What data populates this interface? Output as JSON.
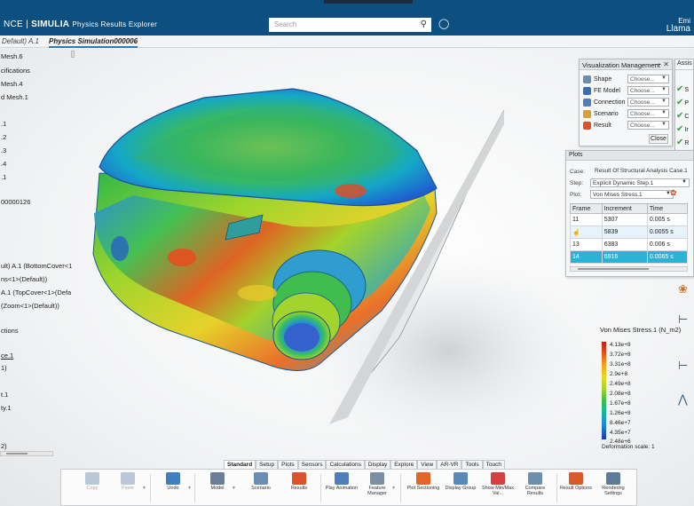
{
  "topbar": {
    "brand_left": "NCE |",
    "brand_mid": "SIMULIA",
    "brand_right": "Physics Results Explorer",
    "search_placeholder": "Search",
    "user_top": "Emi",
    "user_name": "Llama"
  },
  "tabs": [
    {
      "label": "Default) A.1"
    },
    {
      "label": "Physics Simulation000006"
    }
  ],
  "tree": [
    {
      "label": "Mesh.6",
      "y": 0
    },
    {
      "label": "cifications",
      "y": 1
    },
    {
      "label": "Mesh.4",
      "y": 2
    },
    {
      "label": "d Mesh.1",
      "y": 3
    },
    {
      "label": ".1",
      "y": 4
    },
    {
      "label": ".2",
      "y": 5
    },
    {
      "label": ".3",
      "y": 6
    },
    {
      "label": ".4",
      "y": 7
    },
    {
      "label": ".1",
      "y": 8
    },
    {
      "label": "00000126",
      "y": 9
    },
    {
      "label": "ult) A.1 (BottomCover<1",
      "y": 10
    },
    {
      "label": "ns<1>(Default))",
      "y": 11
    },
    {
      "label": "A.1 (TopCover<1>(Defa",
      "y": 12
    },
    {
      "label": "(Zoom<1>(Default))",
      "y": 13
    },
    {
      "label": "ctions",
      "y": 14
    },
    {
      "label": "ce.1",
      "y": 15
    },
    {
      "label": "1)",
      "y": 16
    },
    {
      "label": "t.1",
      "y": 17
    },
    {
      "label": "ty.1",
      "y": 18
    },
    {
      "label": "2)",
      "y": 19
    }
  ],
  "viz": {
    "title": "Visualization Management",
    "rows": [
      {
        "label": "Shape",
        "value": "Choose...",
        "color": "#6c8cb0"
      },
      {
        "label": "FE Model",
        "value": "Choose...",
        "color": "#3a6fb3"
      },
      {
        "label": "Connection",
        "value": "Choose...",
        "color": "#4f7fb8"
      },
      {
        "label": "Scenario",
        "value": "Choose...",
        "color": "#d4a133"
      },
      {
        "label": "Result",
        "value": "Choose...",
        "color": "#d8552f"
      }
    ],
    "close": "Close"
  },
  "assist": {
    "title": "Assis",
    "items": [
      "S",
      "P",
      "C",
      "Ir",
      "R"
    ]
  },
  "plots": {
    "title": "Plots",
    "case_label": "Case:",
    "case_value": "Result Of Structural Analysis Case.1",
    "step_label": "Step:",
    "step_value": "Explicit Dynamic Step.1",
    "plot_label": "Plot:",
    "plot_value": "Von Mises Stress.1",
    "headers": [
      "Frame",
      "Increment",
      "Time"
    ],
    "rows": [
      {
        "frame": "11",
        "inc": "5307",
        "time": "0.005 s"
      },
      {
        "frame": "12",
        "inc": "5839",
        "time": "0.0055 s"
      },
      {
        "frame": "13",
        "inc": "6383",
        "time": "0.006 s"
      },
      {
        "frame": "14",
        "inc": "6916",
        "time": "0.0065 s"
      }
    ]
  },
  "legend": {
    "title": "Von Mises Stress.1 (N_m2)",
    "values": [
      "4.13e+8",
      "3.72e+8",
      "3.31e+8",
      "2.9e+8",
      "2.49e+8",
      "2.08e+8",
      "1.67e+8",
      "1.26e+8",
      "8.46e+7",
      "4.35e+7",
      "2.48e+6"
    ],
    "deformation": "Deformation scale: 1"
  },
  "bottom_tabs": [
    "Standard",
    "Setup",
    "Plots",
    "Sensors",
    "Calculations",
    "Display",
    "Explore",
    "View",
    "AR-VR",
    "Tools",
    "Touch"
  ],
  "ribbon": [
    {
      "label": "Copy",
      "color": "#b9c7d6",
      "disabled": true
    },
    {
      "label": "Paste",
      "color": "#b9c7d6",
      "disabled": true
    },
    {
      "label": "Undo",
      "color": "#3f7fc0",
      "disabled": false
    },
    {
      "label": "Model",
      "color": "#6a7f96",
      "disabled": false
    },
    {
      "label": "Scenario",
      "color": "#6a8eb3",
      "disabled": false
    },
    {
      "label": "Results",
      "color": "#d8532e",
      "disabled": false
    },
    {
      "label": "Play Animation",
      "color": "#4f7fb8",
      "disabled": false
    },
    {
      "label": "Feature Manager",
      "color": "#7b8fa3",
      "disabled": false
    },
    {
      "label": "Plot Sectioning",
      "color": "#e0662b",
      "disabled": false
    },
    {
      "label": "Display Group",
      "color": "#5b89b7",
      "disabled": false
    },
    {
      "label": "Show Min/Max Val...",
      "color": "#d14141",
      "disabled": false
    },
    {
      "label": "Compare Results",
      "color": "#6c8fab",
      "disabled": false
    },
    {
      "label": "Result Options",
      "color": "#d65a2b",
      "disabled": false
    },
    {
      "label": "Rendering Settings",
      "color": "#5d7a98",
      "disabled": false
    }
  ]
}
